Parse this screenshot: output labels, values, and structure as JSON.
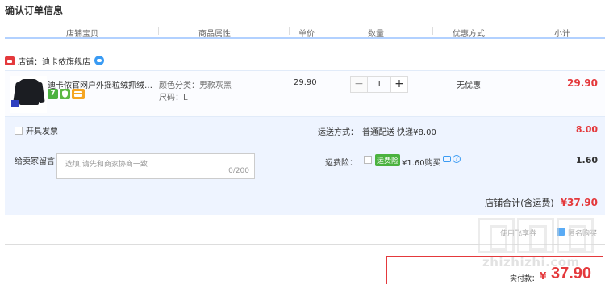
{
  "page": {
    "title": "确认订单信息"
  },
  "columns": [
    "店铺宝贝",
    "商品属性",
    "单价",
    "数量",
    "优惠方式",
    "小计"
  ],
  "shop": {
    "label": "店铺：迪卡侬旗舰店"
  },
  "item": {
    "title": "迪卡侬官网户外摇粒绒抓绒衣套头抓绒衫",
    "attr_color": "颜色分类：男款灰黑",
    "attr_size": "尺码：L",
    "unit_price": "29.90",
    "quantity": "1",
    "qty_minus": "−",
    "qty_plus": "+",
    "discount": "无优惠",
    "subtotal": "29.90",
    "badges": [
      "7",
      "",
      ""
    ]
  },
  "invoice": {
    "label": "开具发票"
  },
  "shipping": {
    "label": "运送方式：",
    "value": "普通配送 快递¥8.00",
    "cost": "8.00"
  },
  "message": {
    "label": "给卖家留言：",
    "placeholder": "选填,请先和商家协商一致",
    "count": "0/200"
  },
  "insurance": {
    "label": "运费险：",
    "tag": "运费险",
    "price": "¥1.60购买",
    "cost": "1.60"
  },
  "shop_total": {
    "label": "店铺合计(含运费)",
    "value": "¥37.90"
  },
  "ghost": {
    "text_a": "使用飞享券",
    "text_b": "匿名购买"
  },
  "payment": {
    "label": "实付款：",
    "currency": "¥",
    "value": "37.90"
  },
  "watermark": {
    "domain": "zhizhizhi.com"
  },
  "colors": {
    "price_red": "#e4393c",
    "panel_blue": "#eef4ff",
    "header_line": "#b2d1ff",
    "badge_green": "#4bb23f"
  }
}
